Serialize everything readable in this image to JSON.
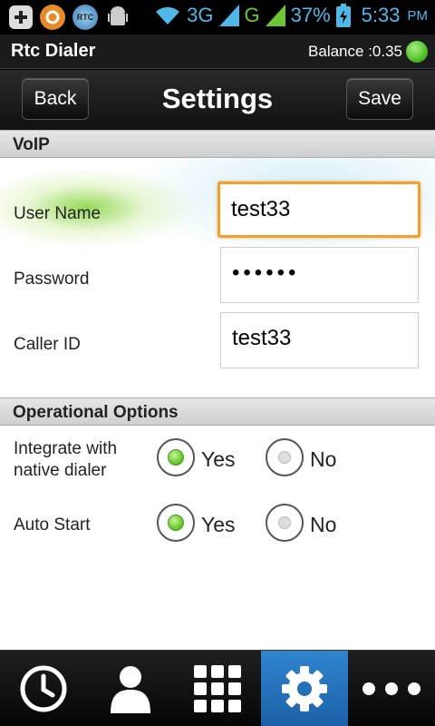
{
  "status_bar": {
    "network_3g": "3G",
    "network_g": "G",
    "battery": "37%",
    "time": "5:33",
    "ampm": "PM",
    "icons": [
      "add-icon",
      "notification-icon",
      "rtc-app-icon",
      "android-debug-icon",
      "wifi-icon",
      "signal-3g-icon",
      "signal-g-icon",
      "battery-charging-icon"
    ],
    "rtc_label": "RTC"
  },
  "title_bar": {
    "app_name": "Rtc Dialer",
    "balance": "Balance :0.35",
    "status_color": "#4fbf2a"
  },
  "nav": {
    "back_label": "Back",
    "title": "Settings",
    "save_label": "Save"
  },
  "voip": {
    "header": "VoIP",
    "fields": [
      {
        "label": "User Name",
        "value": "test33",
        "focused": true
      },
      {
        "label": "Password",
        "value": "••••••"
      },
      {
        "label": "Caller ID",
        "value": "test33"
      }
    ]
  },
  "options": {
    "header": "Operational Options",
    "rows": [
      {
        "label_line1": "Integrate with",
        "label_line2": "native dialer",
        "yes": "Yes",
        "no": "No",
        "selected": "Yes"
      },
      {
        "label_line1": "Auto Start",
        "yes": "Yes",
        "no": "No",
        "selected": "Yes"
      }
    ]
  },
  "tabs": [
    {
      "icon": "clock-icon",
      "active": false
    },
    {
      "icon": "contacts-icon",
      "active": false
    },
    {
      "icon": "dialpad-icon",
      "active": false
    },
    {
      "icon": "gear-icon",
      "active": true
    },
    {
      "icon": "more-icon",
      "active": false
    }
  ],
  "colors": {
    "accent_active_tab": "#2f86cf",
    "focus_border": "#f0a030",
    "radio_selected": "#6cc832",
    "status_blue": "#4fb8e8"
  }
}
